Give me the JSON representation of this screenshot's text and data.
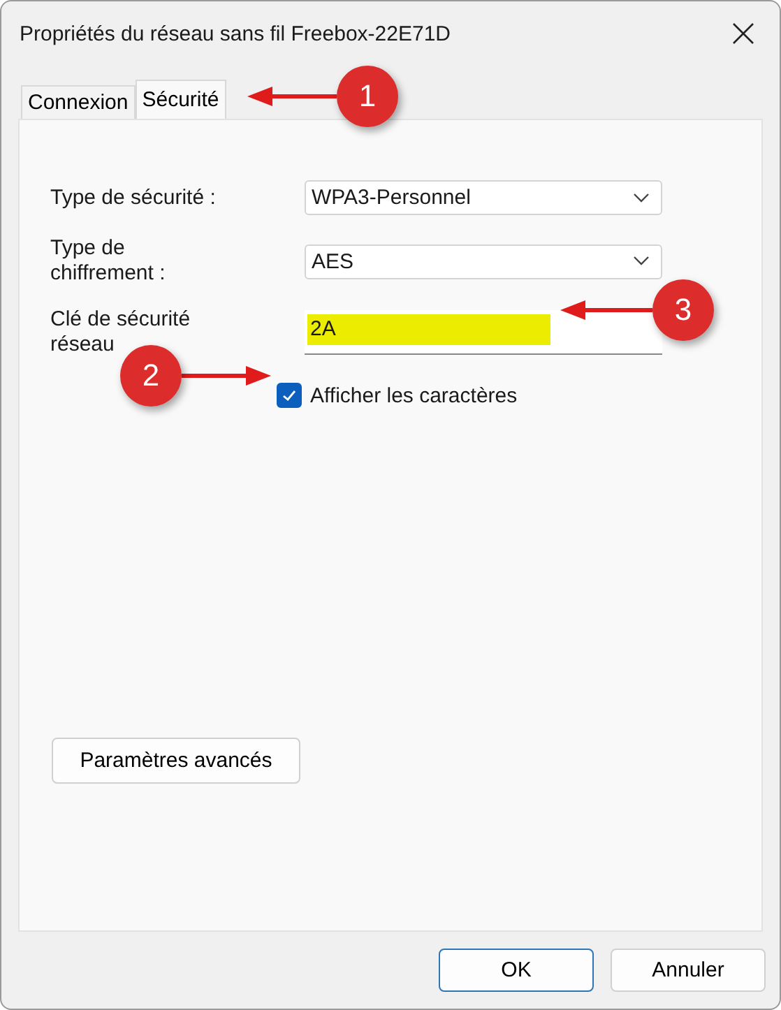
{
  "window": {
    "title": "Propriétés du réseau sans fil Freebox-22E71D"
  },
  "tabs": [
    {
      "label": "Connexion",
      "selected": false
    },
    {
      "label": "Sécurité",
      "selected": true
    }
  ],
  "fields": [
    {
      "kind": "dropdown",
      "label": "Type de sécurité :",
      "value": "WPA3-Personnel"
    },
    {
      "kind": "dropdown",
      "label": "Type de chiffrement :",
      "value": "AES"
    },
    {
      "kind": "key",
      "label": "Clé de sécurité réseau",
      "value": "2A"
    }
  ],
  "show_characters": {
    "label": "Afficher les caractères",
    "checked": true
  },
  "advanced_button": "Paramètres avancés",
  "buttons": [
    {
      "label": "OK",
      "default": true
    },
    {
      "label": "Annuler",
      "default": false
    }
  ],
  "annotations": [
    {
      "number": "1",
      "kind": "left"
    },
    {
      "number": "2",
      "kind": "right"
    },
    {
      "number": "3",
      "kind": "left"
    }
  ]
}
